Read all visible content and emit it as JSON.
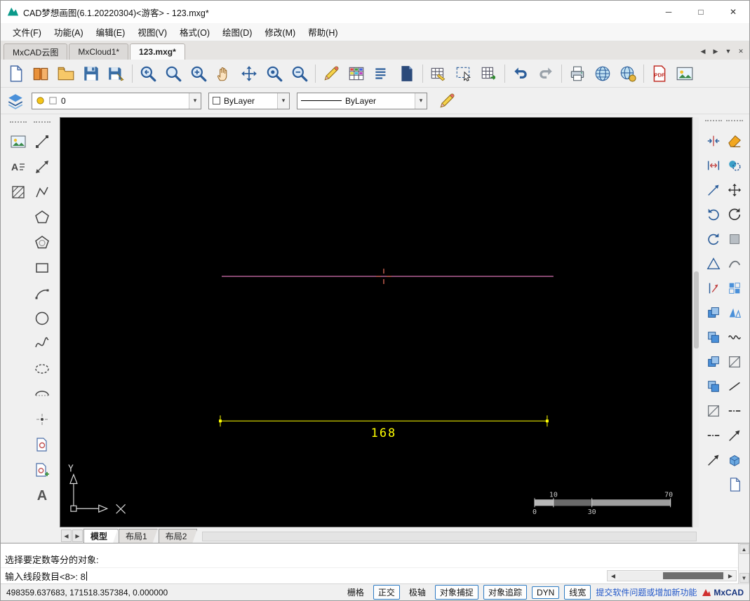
{
  "titlebar": {
    "title": "CAD梦想画图(6.1.20220304)<游客> - 123.mxg*",
    "controls": {
      "minimize": "─",
      "maximize": "□",
      "close": "✕"
    }
  },
  "menubar": {
    "items": [
      "文件(F)",
      "功能(A)",
      "编辑(E)",
      "视图(V)",
      "格式(O)",
      "绘图(D)",
      "修改(M)",
      "帮助(H)"
    ]
  },
  "doc_tabbar": {
    "tabs": [
      "MxCAD云图",
      "MxCloud1*",
      "123.mxg*"
    ],
    "active_index": 2,
    "controls": {
      "prev": "◀",
      "next": "▶",
      "list": "▼",
      "close": "✕"
    }
  },
  "toolbar": {
    "icons": [
      "new-file",
      "open-online",
      "open-file",
      "save",
      "save-as",
      "zoom-previous",
      "zoom-window",
      "zoom-in",
      "pan",
      "zoom-dynamic",
      "zoom-extents",
      "zoom-out",
      "markup-pencil",
      "color-table",
      "text-style",
      "block-manager",
      "table-edit",
      "select-area",
      "table-export",
      "undo",
      "redo",
      "print",
      "web-preview",
      "web-publish",
      "export-pdf",
      "insert-image"
    ],
    "pdf_label": "PDF"
  },
  "properties_bar": {
    "layer": "0",
    "color": "ByLayer",
    "linetype": "ByLayer",
    "arrow": "▾",
    "icons": [
      "layers-icon",
      "layer-state-icon",
      "layer-color-icon",
      "match-properties-pencil-icon"
    ]
  },
  "left_toolbar": {
    "col1": [
      "insert-image",
      "multiline-text",
      "hatch"
    ],
    "col2": [
      "line",
      "construction-line",
      "polyline",
      "polygon",
      "inscribed-polygon",
      "rectangle",
      "arc",
      "circle",
      "spline",
      "ellipse",
      "elliptical-arc",
      "point",
      "block-define",
      "block-insert",
      "single-line-text"
    ],
    "text_letter": "A"
  },
  "right_toolbar": {
    "inner": [
      "edit-join",
      "edit-stretch",
      "edit-measure",
      "rotate-ccw",
      "rotate-cw",
      "polygon-tool",
      "edit-lengthen",
      "paste-block-1",
      "paste-block-2",
      "paste-block-3",
      "paste-block-4",
      "offset-line",
      "break-at-point",
      "reverse-line"
    ],
    "outer": [
      "erase",
      "copy",
      "move",
      "rotate",
      "scale",
      "fillet",
      "array",
      "mirror",
      "spline-fit",
      "chamfer",
      "extend",
      "break",
      "trim",
      "box-3d",
      "new-layout"
    ]
  },
  "canvas": {
    "background": "#000000",
    "line_color": "#f080c8",
    "dimension": {
      "value": "168",
      "color": "#ffff00"
    },
    "ucs_label": "Y",
    "scale_bar": {
      "top_left": "10",
      "top_right": "70",
      "bottom_left": "0",
      "bottom_middle": "30"
    }
  },
  "layout_bar": {
    "prev": "◀",
    "next": "▶",
    "tabs": [
      "模型",
      "布局1",
      "布局2"
    ],
    "active_index": 0
  },
  "command_panel": {
    "history_line": "选择要定数等分的对象:",
    "input_line": "输入线段数目<8>:  8",
    "scroll": {
      "up": "▲",
      "down": "▼",
      "left": "◀",
      "right": "▶"
    }
  },
  "status_bar": {
    "coordinates": "498359.637683,  171518.357384,  0.000000",
    "toggles": [
      {
        "label": "栅格",
        "boxed": false
      },
      {
        "label": "正交",
        "boxed": true
      },
      {
        "label": "极轴",
        "boxed": false
      },
      {
        "label": "对象捕捉",
        "boxed": true
      },
      {
        "label": "对象追踪",
        "boxed": true
      },
      {
        "label": "DYN",
        "boxed": true
      },
      {
        "label": "线宽",
        "boxed": true
      }
    ],
    "link": "提交软件问题或增加新功能",
    "brand": "MxCAD"
  }
}
